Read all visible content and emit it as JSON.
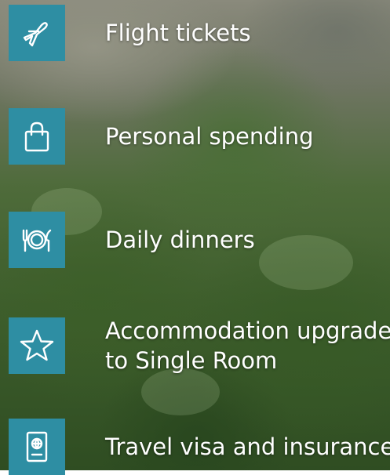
{
  "items": [
    {
      "label": "Flight tickets",
      "icon": "airplane-icon"
    },
    {
      "label": "Personal spending",
      "icon": "shopping-bag-icon"
    },
    {
      "label": "Daily dinners",
      "icon": "plate-cutlery-icon"
    },
    {
      "label_line1": "Accommodation upgrade",
      "label_line2": "to Single Room",
      "icon": "star-icon"
    },
    {
      "label": "Travel visa and insurance",
      "icon": "passport-icon"
    }
  ],
  "colors": {
    "tile": "#2e8ea3",
    "text": "#ffffff"
  }
}
